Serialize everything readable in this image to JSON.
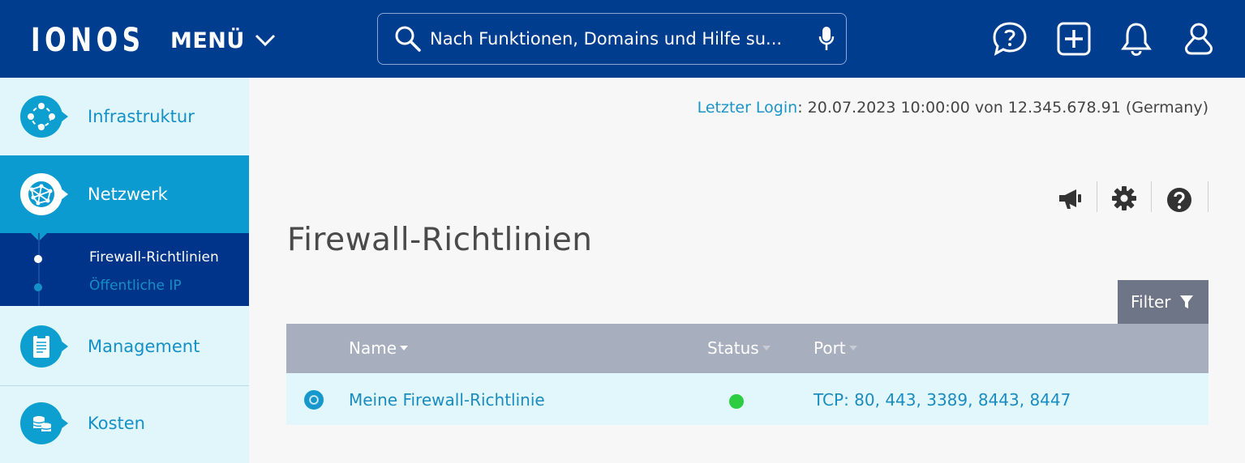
{
  "header": {
    "logo": "IONOS",
    "menu_label": "MENÜ",
    "search_placeholder": "Nach Funktionen, Domains und Hilfe su...",
    "icons": [
      "chat-help-icon",
      "add-icon",
      "bell-icon",
      "user-icon"
    ]
  },
  "sidebar": {
    "items": [
      {
        "label": "Infrastruktur",
        "icon": "infrastructure-icon"
      },
      {
        "label": "Netzwerk",
        "icon": "network-globe-icon",
        "active": true
      },
      {
        "label": "Management",
        "icon": "clipboard-icon"
      },
      {
        "label": "Kosten",
        "icon": "coins-icon"
      }
    ],
    "subitems": [
      {
        "label": "Firewall-Richtlinien",
        "active": true
      },
      {
        "label": "Öffentliche IP",
        "active": false
      }
    ]
  },
  "main": {
    "last_login_key": "Letzter Login",
    "last_login_value": ": 20.07.2023 10:00:00 von 12.345.678.91 (Germany)",
    "tools": [
      "megaphone-icon",
      "gear-icon",
      "help-icon"
    ],
    "title": "Firewall-Richtlinien",
    "filter_label": "Filter",
    "table": {
      "columns": [
        "Name",
        "Status",
        "Port"
      ],
      "rows": [
        {
          "name": "Meine Firewall-Richtlinie",
          "status": "active",
          "port": "TCP: 80, 443, 3389, 8443, 8447"
        }
      ]
    }
  },
  "colors": {
    "header_bg": "#003d8f",
    "accent": "#0b9bd0",
    "status_active": "#2ecc40"
  }
}
